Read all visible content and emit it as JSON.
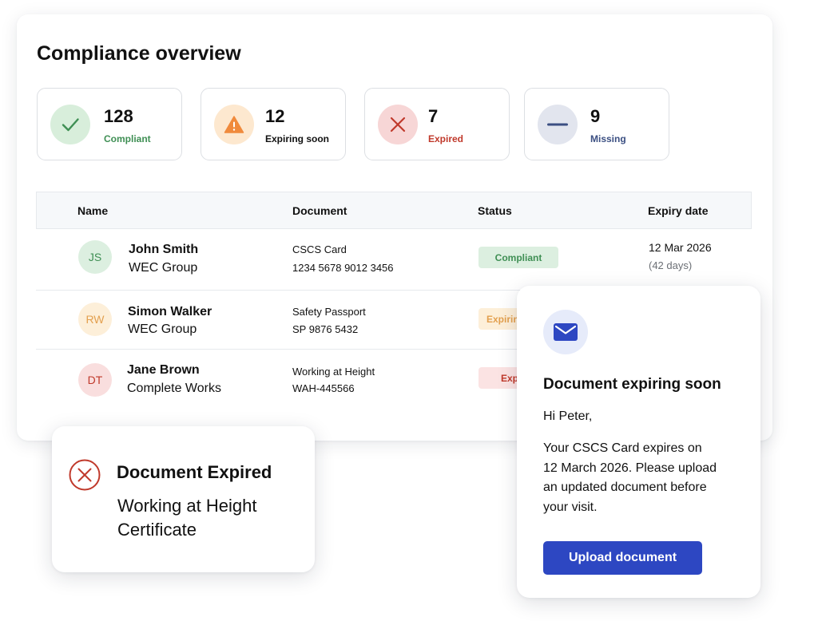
{
  "overview": {
    "title": "Compliance overview",
    "stats": [
      {
        "value": "128",
        "label": "Compliant",
        "icon": "check-icon",
        "color": "#3f8f54",
        "bg": "#d8eedb"
      },
      {
        "value": "12",
        "label": "Expiring soon",
        "icon": "warning-icon",
        "color": "#f08a3c",
        "bg": "#fde8cf"
      },
      {
        "value": "7",
        "label": "Expired",
        "icon": "x-icon",
        "color": "#c0392b",
        "bg": "#f7d6d6"
      },
      {
        "value": "9",
        "label": "Missing",
        "icon": "minus-icon",
        "color": "#3b4f82",
        "bg": "#e2e5ee"
      }
    ]
  },
  "table": {
    "headers": [
      "Name",
      "Document",
      "Status",
      "Expiry date"
    ],
    "rows": [
      {
        "initials": "JS",
        "name": "John Smith",
        "company": "WEC Group",
        "doc_name": "CSCS Card",
        "doc_number": "1234 5678 9012 3456",
        "status": "Compliant",
        "expiry": "12 Mar 2026",
        "remaining": "(42 days)"
      },
      {
        "initials": "RW",
        "name": "Simon Walker",
        "company": "WEC Group",
        "doc_name": "Safety Passport",
        "doc_number": "SP 9876 5432",
        "status": "Expiring",
        "expiry": "",
        "remaining": ""
      },
      {
        "initials": "DT",
        "name": "Jane Brown",
        "company": "Complete Works",
        "doc_name": "Working at Height",
        "doc_number": "WAH-445566",
        "status": "Exp",
        "expiry": "",
        "remaining": ""
      }
    ]
  },
  "expired_notice": {
    "title": "Document Expired",
    "line1": "Working at Height",
    "line2": "Certificate"
  },
  "email_notice": {
    "title": "Document expiring soon",
    "greeting": "Hi Peter,",
    "body_lines": [
      "Your CSCS Card expires on",
      "12 March 2026. Please upload",
      "an updated document before",
      "your visit."
    ],
    "button_label": "Upload document"
  },
  "colors": {
    "accent": "#2d47c2",
    "compliant": "#3f8f54",
    "expiring": "#f08a3c",
    "expired": "#c0392b",
    "missing": "#3b4f82"
  }
}
